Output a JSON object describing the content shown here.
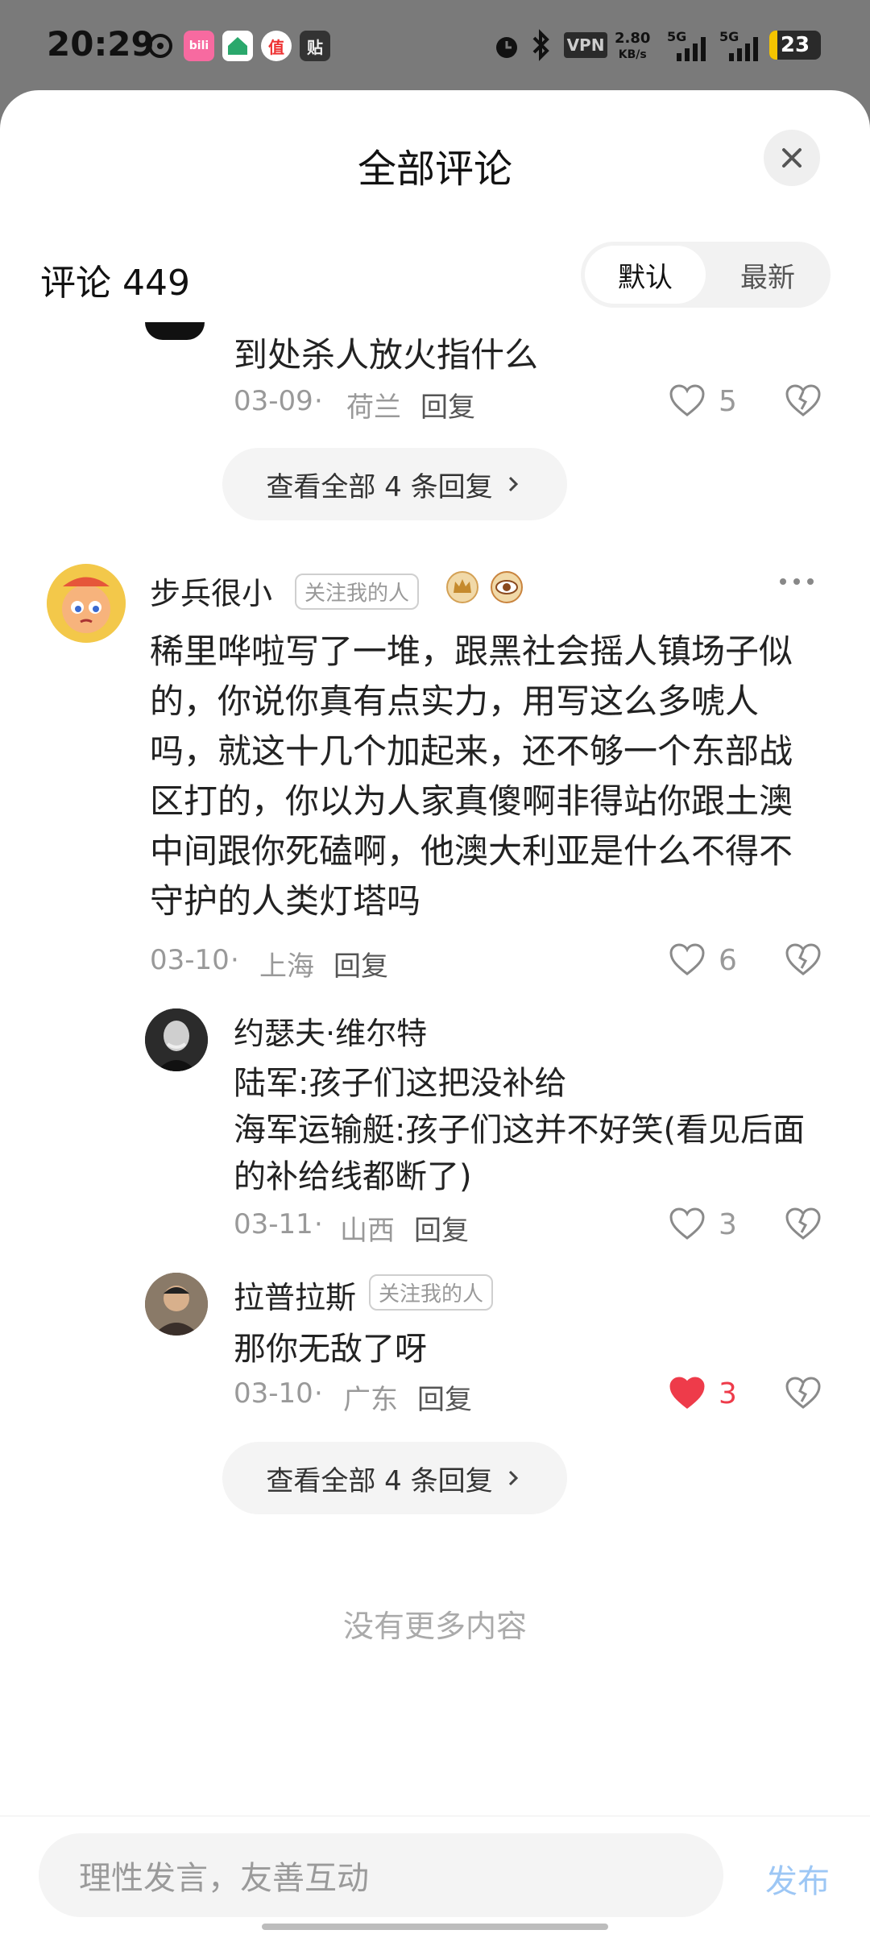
{
  "status_bar": {
    "time": "20:29",
    "speed_value": "2.80",
    "speed_unit": "KB/s",
    "vpn": "VPN",
    "network_a": "5G",
    "network_b": "5G",
    "battery": "23",
    "app_icons": [
      "netease-music-icon",
      "bilibili-icon",
      "home-app-icon",
      "zhide-icon",
      "tieba-icon"
    ]
  },
  "sheet": {
    "title": "全部评论",
    "count_label": "评论 449",
    "sort": {
      "default": "默认",
      "newest": "最新"
    }
  },
  "comments": [
    {
      "text": "到处杀人放火指什么",
      "date": "03-09",
      "location": "荷兰",
      "reply": "回复",
      "likes": "5",
      "more_replies": "查看全部 4 条回复"
    },
    {
      "name": "步兵很小",
      "tag": "关注我的人",
      "text": "稀里哗啦写了一堆，跟黑社会摇人镇场子似的，你说你真有点实力，用写这么多唬人吗，就这十几个加起来，还不够一个东部战区打的，你以为人家真傻啊非得站你跟土澳中间跟你死磕啊，他澳大利亚是什么不得不守护的人类灯塔吗",
      "date": "03-10",
      "location": "上海",
      "reply": "回复",
      "likes": "6",
      "replies": [
        {
          "name": "约瑟夫·维尔特",
          "text": "陆军:孩子们这把没补给\n海军运输艇:孩子们这并不好笑(看见后面的补给线都断了)",
          "date": "03-11",
          "location": "山西",
          "reply": "回复",
          "likes": "3",
          "liked": false
        },
        {
          "name": "拉普拉斯",
          "tag": "关注我的人",
          "text": "那你无敌了呀",
          "date": "03-10",
          "location": "广东",
          "reply": "回复",
          "likes": "3",
          "liked": true
        }
      ],
      "more_replies": "查看全部 4 条回复"
    }
  ],
  "no_more": "没有更多内容",
  "input": {
    "placeholder": "理性发言，友善互动",
    "send": "发布"
  },
  "colors": {
    "liked": "#ee3b4a",
    "send": "#9dc7f5",
    "meta": "#999999"
  }
}
